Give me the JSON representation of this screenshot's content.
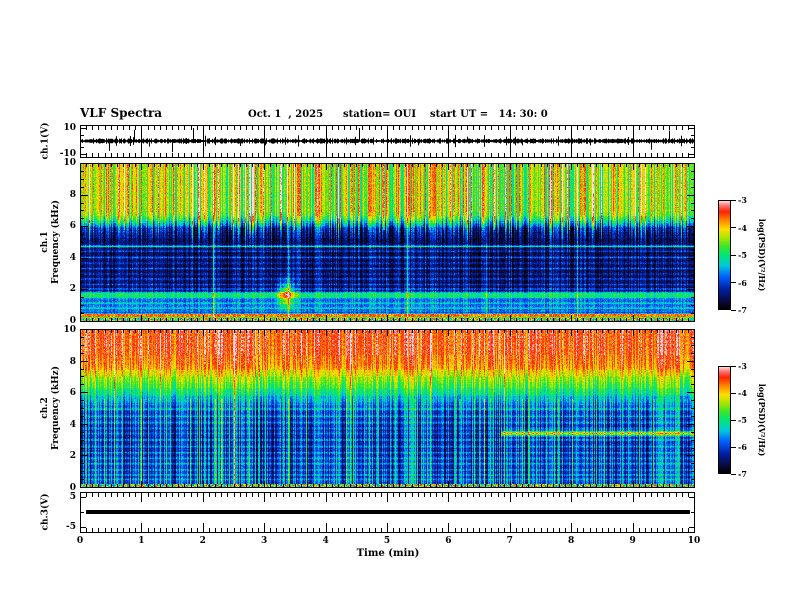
{
  "chart_data": {
    "type": "heatmap",
    "title": "VLF Spectra",
    "date": "Oct. 1  , 2025",
    "station": "station= OUI",
    "start_ut": "start UT =   14: 30: 0",
    "xaxis": {
      "label": "Time (min)",
      "range": [
        0,
        10
      ],
      "major_ticks": [
        0,
        1,
        2,
        3,
        4,
        5,
        6,
        7,
        8,
        9,
        10
      ],
      "minor_step": 0.1
    },
    "freq_axis": {
      "unit": "kHz",
      "range": [
        0,
        10
      ],
      "major_ticks": [
        10,
        8,
        6,
        4,
        2,
        0
      ],
      "minor_step": 0.5
    },
    "labels": {
      "ch1v": "ch.1(V)",
      "ch1_line1": "ch.1",
      "ch1_line2": "Frequency (kHz)",
      "ch2_line1": "ch.2",
      "ch2_line2": "Frequency (kHz)",
      "ch3v": "ch.3(V)"
    },
    "panels": [
      {
        "name": "ch1-voltage",
        "ylabel": "ch.1(V)",
        "ytick_labels": [
          "10",
          "-10"
        ],
        "ytick_values": [
          10,
          -10
        ],
        "ytick_marks": [
          [
            10,
            5
          ],
          [
            5,
            3
          ],
          [
            0,
            5
          ],
          [
            -5,
            3
          ],
          [
            -10,
            5
          ]
        ],
        "yrange": [
          -12.5,
          12.5
        ]
      },
      {
        "name": "ch1-spectrogram",
        "ylabel": "ch.1 Frequency (kHz)"
      },
      {
        "name": "ch2-spectrogram",
        "ylabel": "ch.2 Frequency (kHz)"
      },
      {
        "name": "ch3-voltage",
        "ylabel": "ch.3(V)",
        "ytick_labels": [
          "5",
          "-5"
        ],
        "ytick_values": [
          5,
          -5
        ],
        "ytick_marks": [
          [
            5,
            5
          ],
          [
            0,
            3
          ],
          [
            -5,
            5
          ]
        ],
        "yrange": [
          -6.5,
          6.5
        ]
      }
    ],
    "colormap": [
      [
        0.0,
        "#000000"
      ],
      [
        0.07,
        "#0a0a3c"
      ],
      [
        0.18,
        "#001ea0"
      ],
      [
        0.3,
        "#0060ff"
      ],
      [
        0.4,
        "#00c8dc"
      ],
      [
        0.5,
        "#00e678"
      ],
      [
        0.58,
        "#3ce628"
      ],
      [
        0.66,
        "#aae600"
      ],
      [
        0.74,
        "#ffdd00"
      ],
      [
        0.82,
        "#ff8800"
      ],
      [
        0.9,
        "#ff2200"
      ],
      [
        0.96,
        "#ff7777"
      ],
      [
        1.0,
        "#ffdddd"
      ]
    ],
    "colorbars": [
      {
        "ticks": [
          "-3",
          "-4",
          "-5",
          "-6",
          "-7"
        ],
        "label": "log(PSD)(V²/Hz)"
      },
      {
        "ticks": [
          "-3",
          "-4",
          "-5",
          "-6",
          "-7"
        ],
        "label": "log(PSD)(V²/Hz)"
      }
    ],
    "spectrograms": [
      {
        "channel": "ch.1",
        "seed": 421,
        "base_stops": [
          [
            0,
            0.55
          ],
          [
            0.2,
            0.55
          ],
          [
            0.24,
            0.5
          ],
          [
            0.28,
            0.82
          ],
          [
            0.46,
            0.84
          ],
          [
            0.52,
            0.22
          ],
          [
            0.6,
            0.3
          ],
          [
            1.42,
            0.3
          ],
          [
            1.52,
            0.5
          ],
          [
            1.78,
            0.5
          ],
          [
            1.95,
            0.13
          ],
          [
            3.2,
            0.095
          ],
          [
            4.8,
            0.1
          ],
          [
            5.4,
            0.13
          ],
          [
            5.9,
            0.2
          ],
          [
            6.3,
            0.45
          ],
          [
            6.7,
            0.62
          ],
          [
            7.5,
            0.66
          ],
          [
            10,
            0.66
          ]
        ],
        "streak_stops": [
          [
            0,
            0.06
          ],
          [
            1.8,
            0.07
          ],
          [
            2.0,
            0.1
          ],
          [
            5.0,
            0.1
          ],
          [
            5.8,
            0.2
          ],
          [
            6.3,
            0.22
          ],
          [
            10,
            0.22
          ]
        ],
        "noise": 0.055,
        "hlines": [
          [
            4.75,
            0.4
          ],
          [
            4.45,
            0.15
          ],
          [
            4.05,
            0.18
          ],
          [
            3.7,
            0.14
          ],
          [
            3.35,
            0.16
          ],
          [
            3.0,
            0.12
          ],
          [
            2.7,
            0.14
          ],
          [
            2.35,
            0.12
          ],
          [
            2.05,
            0.16
          ],
          [
            1.15,
            0.12
          ],
          [
            0.85,
            0.14
          ]
        ],
        "vlines": [
          [
            2.16,
            0.28
          ],
          [
            3.39,
            0.3
          ],
          [
            5.33,
            0.25
          ],
          [
            6.62,
            0.25
          ],
          [
            8.1,
            0.18
          ]
        ],
        "tall": {
          "thresh": 0.84,
          "amp": 0.38,
          "f0": 4.3,
          "f1": 6.9,
          "mode": "ramp"
        },
        "hot": {
          "thresh": 0.93,
          "amp": 0.28,
          "fmin": 5.8
        },
        "burst": {
          "t": 3.35,
          "f": 1.75,
          "amp": 0.45,
          "sigt": 0.09,
          "sigf": 0.6
        },
        "bottom_mottle_f": 0.2
      },
      {
        "channel": "ch.2",
        "seed": 777,
        "base_stops": [
          [
            0,
            0.3
          ],
          [
            0.25,
            0.26
          ],
          [
            1.0,
            0.23
          ],
          [
            2.2,
            0.21
          ],
          [
            3.4,
            0.21
          ],
          [
            4.4,
            0.23
          ],
          [
            5.0,
            0.28
          ],
          [
            5.4,
            0.36
          ],
          [
            5.9,
            0.47
          ],
          [
            6.4,
            0.57
          ],
          [
            7.0,
            0.68
          ],
          [
            7.6,
            0.8
          ],
          [
            8.4,
            0.88
          ],
          [
            10,
            0.9
          ]
        ],
        "streak_stops": [
          [
            0,
            0.17
          ],
          [
            4.8,
            0.17
          ],
          [
            6,
            0.13
          ],
          [
            10,
            0.11
          ]
        ],
        "noise": 0.045,
        "hlines": [
          [
            4.95,
            0.16
          ],
          [
            4.5,
            0.14
          ],
          [
            4.1,
            0.16
          ],
          [
            3.75,
            0.12
          ],
          [
            3.42,
            0.1
          ],
          [
            3.0,
            0.15
          ],
          [
            2.6,
            0.12
          ],
          [
            2.2,
            0.15
          ],
          [
            1.85,
            0.12
          ],
          [
            1.5,
            0.15
          ],
          [
            1.1,
            0.12
          ],
          [
            0.8,
            0.14
          ],
          [
            0.5,
            0.12
          ]
        ],
        "vlines": [
          [
            0.55,
            0.2
          ],
          [
            1.3,
            0.22
          ],
          [
            2.5,
            0.2
          ],
          [
            3.6,
            0.22
          ],
          [
            4.4,
            0.2
          ],
          [
            5.7,
            0.22
          ],
          [
            6.9,
            0.2
          ],
          [
            8.2,
            0.22
          ],
          [
            9.4,
            0.2
          ]
        ],
        "tall": {
          "thresh": 0.8,
          "amp": 0.22,
          "f0": 0,
          "f1": 5.6,
          "mode": "flat"
        },
        "right_band": {
          "f": 3.42,
          "hw": 0.12,
          "t_start": 6.85,
          "amp": 0.42
        },
        "bottom_mottle_f": 0.2
      }
    ],
    "waveforms": [
      {
        "channel": "ch.1",
        "seed": 99,
        "yrange": [
          -12.5,
          12.5
        ],
        "noise_min": 0.6,
        "noise_max": 2.2,
        "spike_prob": 0.05,
        "spike_extra": 3.5,
        "spikes": [
          [
            0.47,
            -8
          ],
          [
            0.88,
            9
          ],
          [
            1.13,
            -4.5
          ],
          [
            1.5,
            -9
          ],
          [
            1.84,
            10.5
          ],
          [
            2.6,
            -4
          ],
          [
            3.02,
            -3.5
          ],
          [
            4.55,
            10.5
          ],
          [
            5.5,
            -3.5
          ],
          [
            6.3,
            3.5
          ],
          [
            7.2,
            -3.5
          ],
          [
            8.3,
            -3.5
          ],
          [
            9.3,
            -7
          ],
          [
            9.6,
            8.5
          ]
        ]
      },
      {
        "channel": "ch.3",
        "yrange": [
          -6.5,
          6.5
        ],
        "flat": 0,
        "thickness": 4,
        "t0": 0.1,
        "t1": 9.93
      }
    ]
  }
}
